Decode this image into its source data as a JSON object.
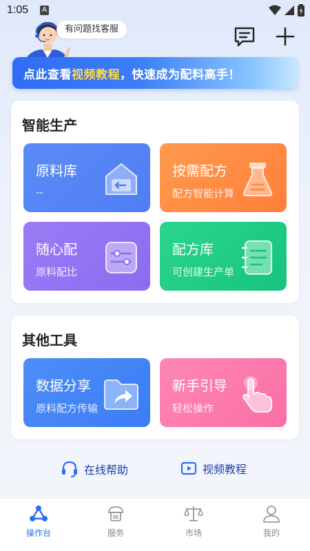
{
  "status_bar": {
    "time": "1:05",
    "notification_letter": "A"
  },
  "header": {
    "help_bubble": "有问题找客服",
    "message_icon": "message-icon",
    "add_icon": "plus-icon"
  },
  "banner": {
    "prefix": "点此查看",
    "highlight": "视频教程",
    "suffix": "，快速成为配料高手！",
    "colors": {
      "highlight": "#ffd84a"
    }
  },
  "smart_production": {
    "title": "智能生产",
    "tiles": [
      {
        "title": "原料库",
        "sub": "--",
        "icon": "house-arrow-icon",
        "color": "#5a8cf6"
      },
      {
        "title": "按需配方",
        "sub": "配方智能计算",
        "icon": "flask-icon",
        "color": "#ff8a42"
      },
      {
        "title": "随心配",
        "sub": "原料配比",
        "icon": "sliders-icon",
        "color": "#9177f3"
      },
      {
        "title": "配方库",
        "sub": "可创建生产单",
        "icon": "notebook-icon",
        "color": "#1fcc84"
      }
    ]
  },
  "other_tools": {
    "title": "其他工具",
    "tiles": [
      {
        "title": "数据分享",
        "sub": "原料配方传输",
        "icon": "folder-share-icon",
        "color": "#4585f7"
      },
      {
        "title": "新手引导",
        "sub": "轻松操作",
        "icon": "finger-tap-icon",
        "color": "#fb7aad"
      }
    ]
  },
  "links": [
    {
      "label": "在线帮助",
      "icon": "headset-icon"
    },
    {
      "label": "视频教程",
      "icon": "play-video-icon"
    }
  ],
  "tabbar": {
    "tabs": [
      {
        "label": "操作台",
        "icon": "workbench-icon",
        "active": true
      },
      {
        "label": "服务",
        "icon": "service-icon",
        "active": false
      },
      {
        "label": "市场",
        "icon": "scale-icon",
        "active": false
      },
      {
        "label": "我的",
        "icon": "user-icon",
        "active": false
      }
    ],
    "colors": {
      "active": "#2b6ef5",
      "inactive": "#888888"
    }
  }
}
